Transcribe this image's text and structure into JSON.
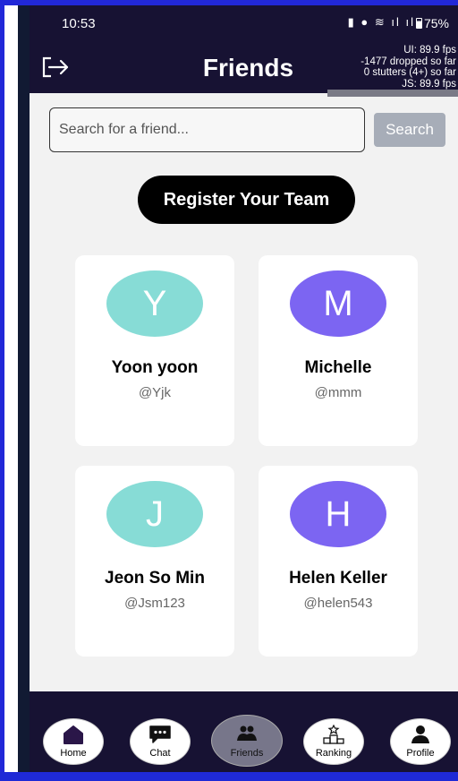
{
  "status_bar": {
    "time": "10:53",
    "icons": "▮ ● ≋ ıl ıl",
    "battery": "75%"
  },
  "header": {
    "title": "Friends",
    "perf": [
      "UI: 89.9 fps",
      "-1477 dropped so far",
      "0 stutters (4+) so far",
      "JS: 89.9 fps"
    ]
  },
  "search": {
    "placeholder": "Search for a friend...",
    "button_label": "Search"
  },
  "register_label": "Register Your Team",
  "friends": [
    {
      "initial": "Y",
      "name": "Yoon yoon",
      "handle": "@Yjk",
      "color": "#87dcd6"
    },
    {
      "initial": "M",
      "name": "Michelle",
      "handle": "@mmm",
      "color": "#7c65f2"
    },
    {
      "initial": "J",
      "name": "Jeon So Min",
      "handle": "@Jsm123",
      "color": "#87dcd6"
    },
    {
      "initial": "H",
      "name": "Helen Keller",
      "handle": "@helen543",
      "color": "#7c65f2"
    }
  ],
  "tabs": [
    {
      "label": "Home",
      "icon": "home-icon"
    },
    {
      "label": "Chat",
      "icon": "chat-icon"
    },
    {
      "label": "Friends",
      "icon": "friends-icon",
      "active": true
    },
    {
      "label": "Ranking",
      "icon": "ranking-icon"
    },
    {
      "label": "Profile",
      "icon": "profile-icon"
    }
  ]
}
